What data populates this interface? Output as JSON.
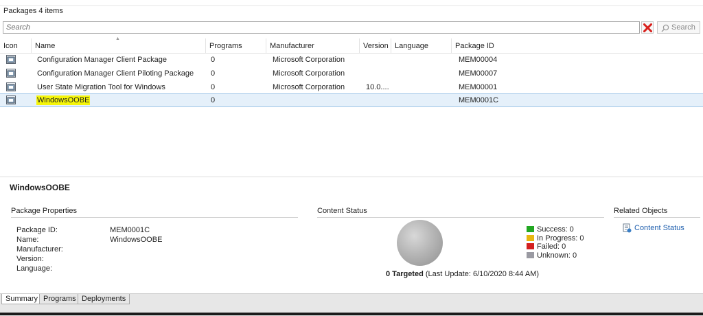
{
  "header": {
    "title": "Packages 4 items"
  },
  "search": {
    "placeholder": "Search",
    "button_label": "Search"
  },
  "columns": [
    "Icon",
    "Name",
    "Programs",
    "Manufacturer",
    "Version",
    "Language",
    "Package ID"
  ],
  "rows": [
    {
      "name": "Configuration Manager Client Package",
      "programs": "0",
      "manufacturer": "Microsoft Corporation",
      "version": "",
      "language": "",
      "package_id": "MEM00004",
      "icon": "package-icon"
    },
    {
      "name": "Configuration Manager Client Piloting Package",
      "programs": "0",
      "manufacturer": "Microsoft Corporation",
      "version": "",
      "language": "",
      "package_id": "MEM00007",
      "icon": "package-icon"
    },
    {
      "name": "User State Migration Tool for Windows",
      "programs": "0",
      "manufacturer": "Microsoft Corporation",
      "version": "10.0....",
      "language": "",
      "package_id": "MEM00001",
      "icon": "package-icon"
    },
    {
      "name": "WindowsOOBE",
      "programs": "0",
      "manufacturer": "",
      "version": "",
      "language": "",
      "package_id": "MEM0001C",
      "icon": "package-icon",
      "selected": true
    }
  ],
  "details": {
    "title": "WindowsOOBE",
    "properties": {
      "section_title": "Package Properties",
      "items": [
        {
          "label": "Package ID:",
          "value": "MEM0001C"
        },
        {
          "label": "Name:",
          "value": "WindowsOOBE"
        },
        {
          "label": "Manufacturer:",
          "value": ""
        },
        {
          "label": "Version:",
          "value": ""
        },
        {
          "label": "Language:",
          "value": ""
        }
      ]
    },
    "content_status": {
      "section_title": "Content Status",
      "targeted_count": "0 Targeted",
      "last_update": "(Last Update: 6/10/2020 8:44 AM)",
      "legend": [
        {
          "label": "Success: 0",
          "color": "#22a722"
        },
        {
          "label": "In Progress: 0",
          "color": "#e8b810"
        },
        {
          "label": "Failed: 0",
          "color": "#d42020"
        },
        {
          "label": "Unknown: 0",
          "color": "#9a9aa2"
        }
      ]
    },
    "related_objects": {
      "section_title": "Related Objects",
      "link_label": "Content Status",
      "icon": "content-status-icon"
    }
  },
  "tabs": [
    {
      "label": "Summary",
      "active": true
    },
    {
      "label": "Programs",
      "active": false
    },
    {
      "label": "Deployments",
      "active": false
    }
  ],
  "colors": {
    "selection": "#e5f0fa",
    "highlight": "#f5f50a",
    "link": "#1f5fae"
  }
}
